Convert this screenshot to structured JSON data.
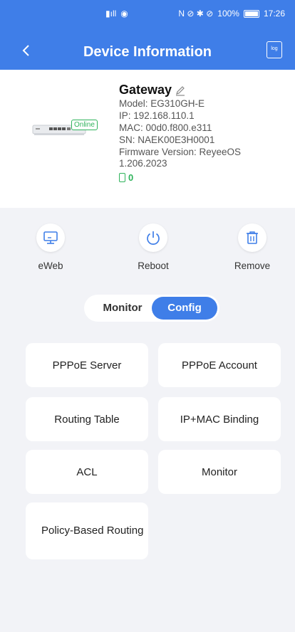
{
  "status_bar": {
    "left_icons": [
      "📶"
    ],
    "battery_text": "100%",
    "time": "17:26",
    "right_icons": "N ⊘ ✱ ⊘"
  },
  "nav": {
    "title": "Device Information",
    "log_label": "log"
  },
  "device": {
    "name": "Gateway",
    "status": "Online",
    "model": "Model: EG310GH-E",
    "ip": "IP:  192.168.110.1",
    "mac": "MAC:  00d0.f800.e311",
    "sn": "SN: NAEK00E3H0001",
    "firmware": "Firmware Version: ReyeeOS 1.206.2023",
    "clients": "0"
  },
  "actions": [
    {
      "label": "eWeb",
      "icon": "monitor-icon"
    },
    {
      "label": "Reboot",
      "icon": "power-icon"
    },
    {
      "label": "Remove",
      "icon": "trash-icon"
    }
  ],
  "toggle": {
    "monitor": "Monitor",
    "config": "Config",
    "selected": "Config"
  },
  "config_items": [
    {
      "label": "PPPoE Server"
    },
    {
      "label": "PPPoE Account"
    },
    {
      "label": "Routing Table"
    },
    {
      "label": "IP+MAC Binding"
    },
    {
      "label": "ACL"
    },
    {
      "label": "Monitor"
    },
    {
      "label": "Policy-Based Routing"
    }
  ],
  "colors": {
    "accent": "#3f7ee8",
    "online": "#2fb35b",
    "background": "#f2f3f7"
  }
}
